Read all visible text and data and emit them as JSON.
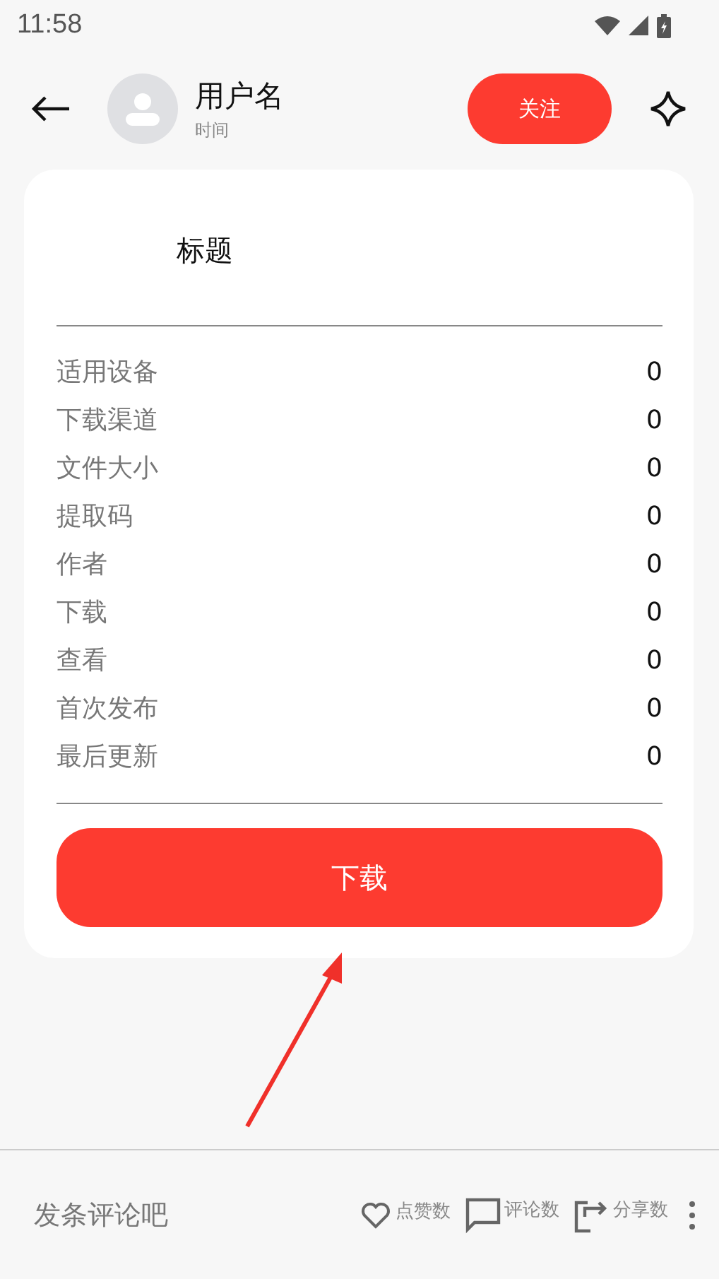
{
  "status_bar": {
    "time": "11:58"
  },
  "header": {
    "username": "用户名",
    "time": "时间",
    "follow_button": "关注"
  },
  "card": {
    "title": "标题",
    "rows": [
      {
        "label": "适用设备",
        "value": "0"
      },
      {
        "label": "下载渠道",
        "value": "0"
      },
      {
        "label": "文件大小",
        "value": "0"
      },
      {
        "label": "提取码",
        "value": "0"
      },
      {
        "label": "作者",
        "value": "0"
      },
      {
        "label": "下载",
        "value": "0"
      },
      {
        "label": "查看",
        "value": "0"
      },
      {
        "label": "首次发布",
        "value": "0"
      },
      {
        "label": "最后更新",
        "value": "0"
      }
    ],
    "download_button": "下载"
  },
  "bottom_bar": {
    "comment_placeholder": "发条评论吧",
    "actions": [
      {
        "kind": "like",
        "label": "点赞数"
      },
      {
        "kind": "comment",
        "label": "评论数"
      },
      {
        "kind": "share",
        "label": "分享数"
      }
    ]
  }
}
